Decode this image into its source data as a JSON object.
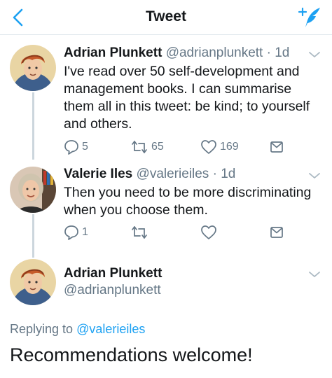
{
  "header": {
    "title": "Tweet"
  },
  "tweets": [
    {
      "name": "Adrian Plunkett",
      "handle": "@adrianplunkett",
      "time": "· 1d",
      "text_lines": [
        "I've read over 50 self-development and",
        "management books. I can summarise",
        "them all in this tweet: be kind; to yourself",
        "and others."
      ],
      "replies": "5",
      "retweets": "65",
      "likes": "169"
    },
    {
      "name": "Valerie Iles",
      "handle": "@valerieiles",
      "time": "· 1d",
      "text_lines": [
        "Then you need to be more discriminating",
        "when you choose them."
      ],
      "replies": "1"
    }
  ],
  "focus": {
    "name": "Adrian Plunkett",
    "handle": "@adrianplunkett",
    "replying_prefix": "Replying to",
    "replying_to": "@valerieiles",
    "text": "Recommendations welcome!"
  },
  "colors": {
    "accent": "#1da1f2",
    "muted": "#657786",
    "text": "#14171a",
    "line": "#ccd6dd"
  },
  "icons": [
    "back-icon",
    "compose-icon",
    "caret-down-icon",
    "reply-icon",
    "retweet-icon",
    "like-icon",
    "share-icon"
  ]
}
